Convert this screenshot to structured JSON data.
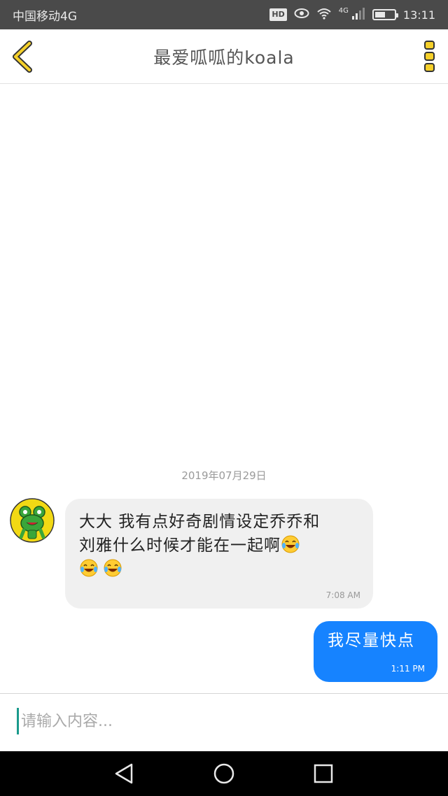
{
  "status_bar": {
    "carrier": "中国移动4G",
    "hd_badge": "HD",
    "network_type": "4G",
    "battery_level": 0.55,
    "time": "13:11"
  },
  "header": {
    "title": "最爱呱呱的koala",
    "back_icon": "chevron-left-icon",
    "menu_icon": "more-vertical-icon",
    "accent_color": "#f5d02a"
  },
  "chat": {
    "date_label": "2019年07月29日",
    "messages": [
      {
        "direction": "incoming",
        "line1": "大大 我有点好奇剧情设定乔乔和",
        "line2": "刘雅什么时候才能在一起啊",
        "emojis": [
          "tears-of-joy-emoji",
          "tears-of-joy-emoji",
          "tears-of-joy-emoji"
        ],
        "time": "7:08 AM"
      },
      {
        "direction": "outgoing",
        "text": "我尽量快点",
        "time": "1:11 PM"
      }
    ]
  },
  "input": {
    "placeholder": "请输入内容..."
  },
  "colors": {
    "status_bar_bg": "#4a4a4a",
    "incoming_bubble": "#f0f0f0",
    "outgoing_bubble": "#1683ff",
    "caret": "#1a9a8c"
  },
  "nav_bar": {
    "icons": [
      "back-triangle-icon",
      "home-circle-icon",
      "recents-square-icon"
    ]
  }
}
